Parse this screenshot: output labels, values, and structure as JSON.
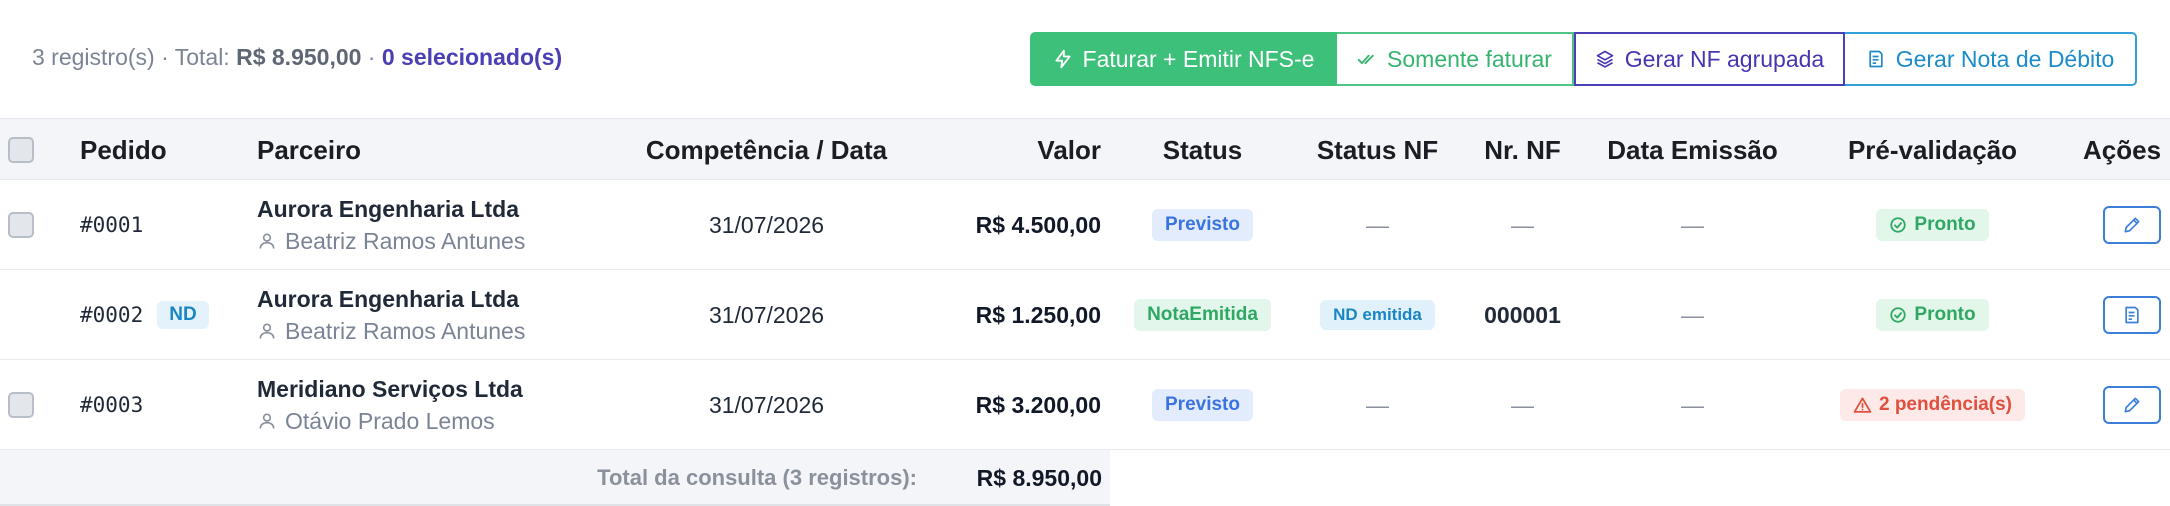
{
  "summary": {
    "count_text": "3 registro(s) · Total: ",
    "total_amount": "R$ 8.950,00",
    "separator": " · ",
    "selected_text": "0 selecionado(s)"
  },
  "toolbar": {
    "faturar_emitir": "Faturar + Emitir NFS-e",
    "somente_faturar": "Somente faturar",
    "gerar_nf_agrupada": "Gerar NF agrupada",
    "gerar_nota_debito": "Gerar Nota de Débito"
  },
  "table": {
    "columns": [
      "Pedido",
      "Parceiro",
      "Competência / Data",
      "Valor",
      "Status",
      "Status NF",
      "Nr. NF",
      "Data Emissão",
      "Pré-validação",
      "Ações"
    ],
    "rows": [
      {
        "pedido": "#0001",
        "tag": "",
        "parceiro": "Aurora Engenharia Ltda",
        "contato": "Beatriz Ramos Antunes",
        "data": "31/07/2026",
        "valor": "R$ 4.500,00",
        "status": "Previsto",
        "status_nf": "—",
        "nr_nf": "—",
        "data_emissao": "—",
        "pre_validacao": "Pronto"
      },
      {
        "pedido": "#0002",
        "tag": "ND",
        "parceiro": "Aurora Engenharia Ltda",
        "contato": "Beatriz Ramos Antunes",
        "data": "31/07/2026",
        "valor": "R$ 1.250,00",
        "status": "NotaEmitida",
        "status_nf": "ND emitida",
        "nr_nf": "000001",
        "data_emissao": "—",
        "pre_validacao": "Pronto"
      },
      {
        "pedido": "#0003",
        "tag": "",
        "parceiro": "Meridiano Serviços Ltda",
        "contato": "Otávio Prado Lemos",
        "data": "31/07/2026",
        "valor": "R$ 3.200,00",
        "status": "Previsto",
        "status_nf": "—",
        "nr_nf": "—",
        "data_emissao": "—",
        "pre_validacao": "2 pendência(s)"
      }
    ],
    "footer": {
      "label": "Total da consulta (3 registros):",
      "total": "R$ 8.950,00"
    }
  },
  "colors": {
    "green": "#3dc07a",
    "indigo": "#4a3fb5",
    "blue": "#33a0d8",
    "header_bg": "#f3f5f8"
  },
  "icons": {
    "faturar": "lightning-icon",
    "somente": "double-check-icon",
    "agrupada": "layers-icon",
    "debito": "document-icon",
    "contato": "user-icon",
    "pronto": "check-circle-icon",
    "pendencia": "warning-icon",
    "editar": "pencil-icon"
  }
}
